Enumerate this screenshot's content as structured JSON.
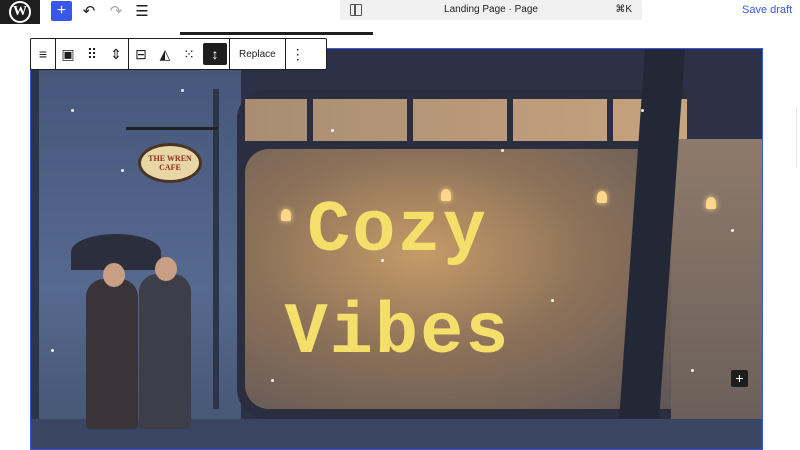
{
  "topbar": {
    "logo_glyph": "W",
    "add_icon": "plus-icon",
    "undo_icon": "undo-icon",
    "redo_icon": "redo-icon",
    "list_view_icon": "list-view-icon",
    "document_title": "Landing Page · Page",
    "shortcut": "⌘K",
    "save_draft": "Save draft",
    "accent_color": "#3858e9"
  },
  "block_toolbar": {
    "icons": [
      "align-icon",
      "cover-block-icon",
      "drag-handle-icon",
      "move-up-down-icon",
      "content-position-icon",
      "duotone-icon",
      "grid-icon",
      "full-height-icon",
      "more-options-icon"
    ],
    "replace_label": "Replace"
  },
  "cover": {
    "heading_line1": "Cozy",
    "heading_line2": "Vibes",
    "heading_color": "#f3df6a",
    "sign_line1": "THE WREN",
    "sign_line2": "CAFE",
    "insert_icon": "plus-icon"
  }
}
